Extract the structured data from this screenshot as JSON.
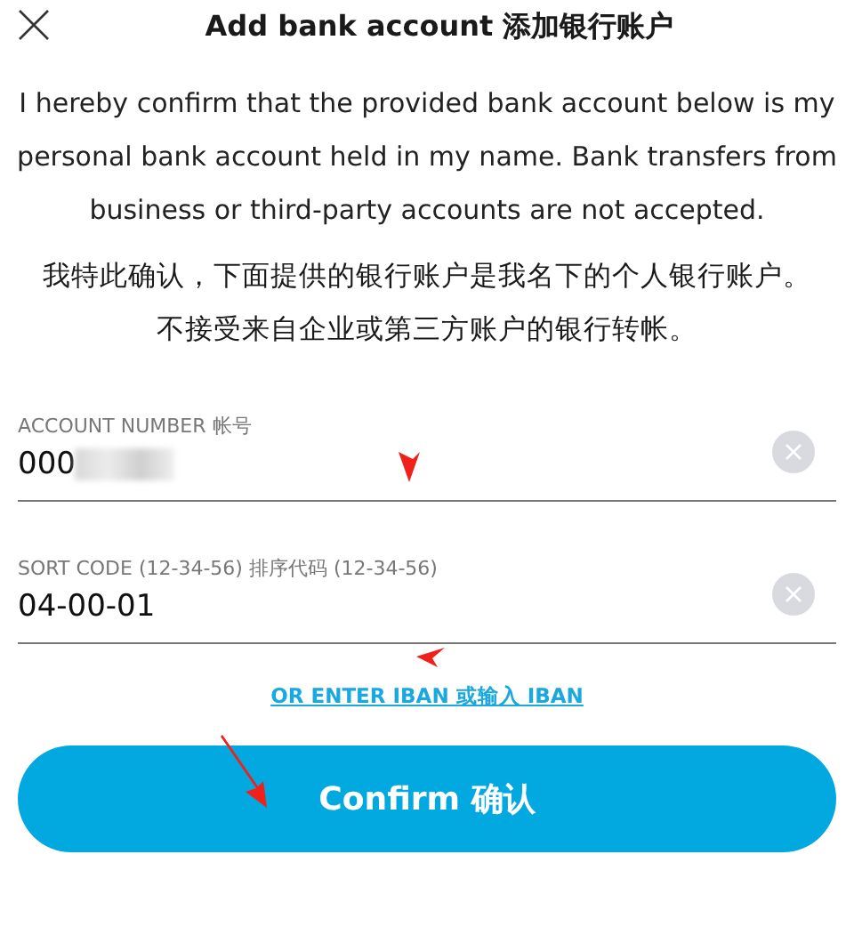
{
  "header": {
    "title": "Add bank account 添加银行账户"
  },
  "notice_en": "I hereby confirm that the provided bank account below is my personal bank account held in my name. Bank transfers from business or third-party accounts are not accepted.",
  "notice_zh": [
    "我特此确认，下面提供的银行账户是我名下的个人银行账户。",
    "不接受来自企业或第三方账户的银行转帐。"
  ],
  "fields": [
    {
      "label": "ACCOUNT NUMBER 帐号",
      "value": "000",
      "redacted": true
    },
    {
      "label": "SORT CODE (12-34-56) 排序代码 (12-34-56)",
      "value": "04-00-01",
      "redacted": false
    }
  ],
  "iban_link": "OR ENTER IBAN 或输入 IBAN",
  "confirm_button": "Confirm 确认"
}
